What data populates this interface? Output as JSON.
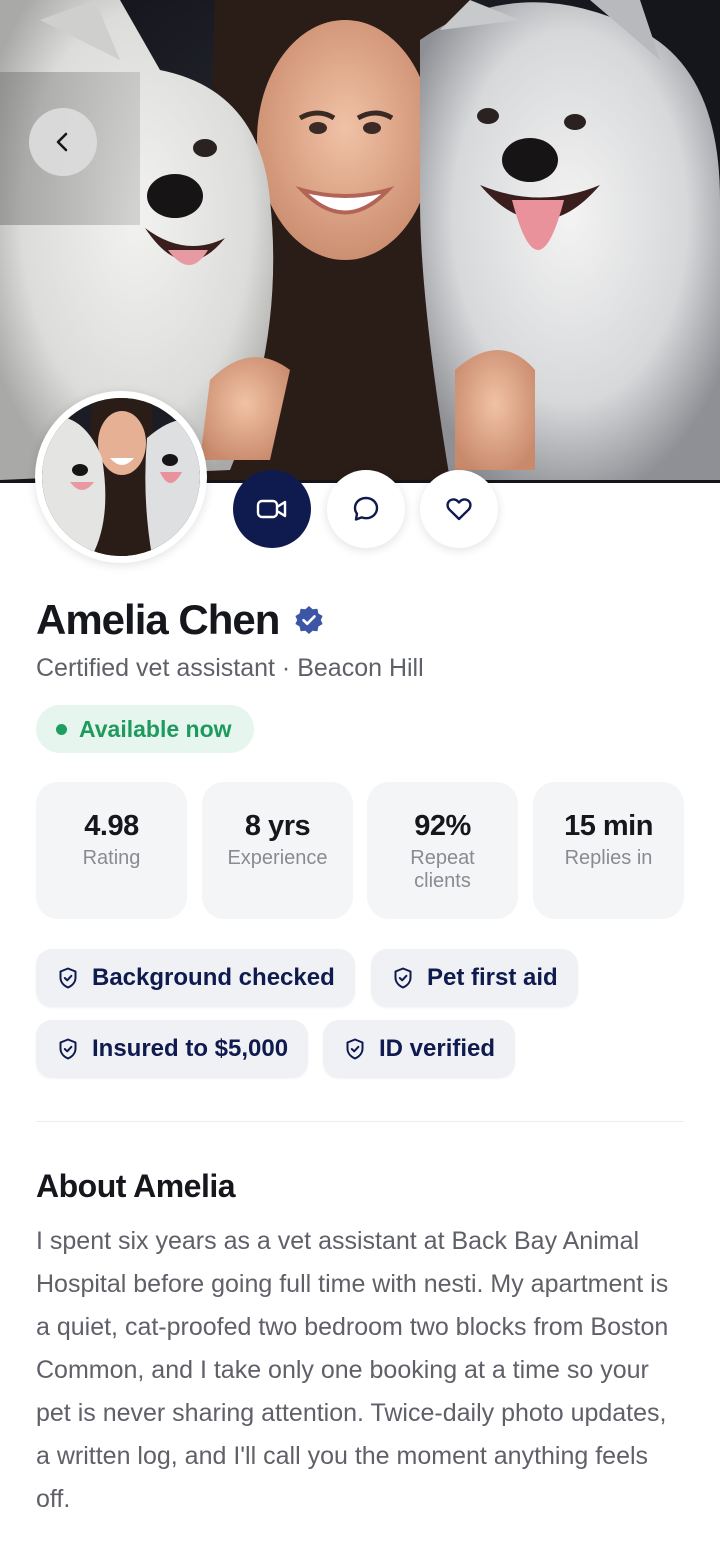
{
  "profile": {
    "name": "Amelia Chen",
    "subtitle": "Certified vet assistant · Beacon Hill",
    "availability": "Available now"
  },
  "actions": {
    "back_icon": "chevron-left-icon",
    "video_icon": "video-camera-icon",
    "chat_icon": "chat-bubble-icon",
    "favorite_icon": "heart-icon"
  },
  "stats": [
    {
      "value": "4.98",
      "label": "Rating"
    },
    {
      "value": "8 yrs",
      "label": "Experience"
    },
    {
      "value": "92%",
      "label": "Repeat clients"
    },
    {
      "value": "15 min",
      "label": "Replies in"
    }
  ],
  "badges": [
    {
      "label": "Background checked"
    },
    {
      "label": "Pet first aid"
    },
    {
      "label": "Insured to $5,000"
    },
    {
      "label": "ID verified"
    }
  ],
  "about": {
    "title": "About Amelia",
    "text": "I spent six years as a vet assistant at Back Bay Animal Hospital before going full time with nesti. My apartment is a quiet, cat-proofed two bedroom two blocks from Boston Common, and I take only one booking at a time so your pet is never sharing attention. Twice-daily photo updates, a written log, and I'll call you the moment anything feels off."
  },
  "colors": {
    "brand_navy": "#0f1a4f",
    "available_green": "#1e9a5e",
    "verified_blue": "#3d55a6"
  }
}
